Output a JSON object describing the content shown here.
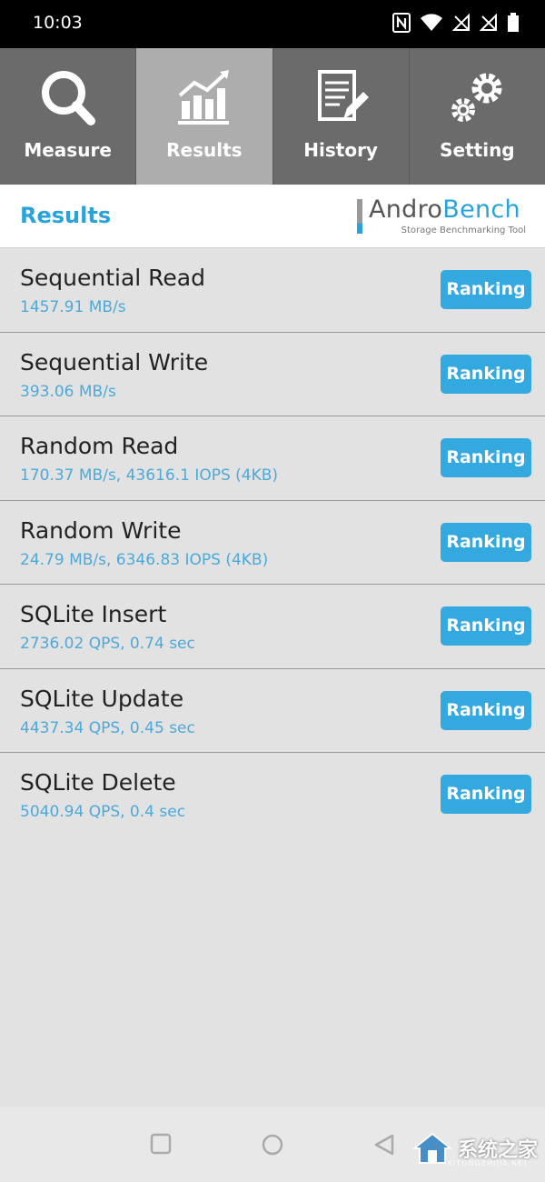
{
  "status_bar": {
    "time": "10:03",
    "icons": [
      "nfc-icon",
      "wifi-icon",
      "no-signal-icon",
      "no-signal-icon",
      "battery-icon"
    ]
  },
  "tabs": [
    {
      "label": "Measure",
      "icon": "magnifier-icon",
      "active": false
    },
    {
      "label": "Results",
      "icon": "chart-icon",
      "active": true
    },
    {
      "label": "History",
      "icon": "document-edit-icon",
      "active": false
    },
    {
      "label": "Setting",
      "icon": "gears-icon",
      "active": false
    }
  ],
  "header": {
    "title": "Results",
    "logo_andro": "Andro",
    "logo_bench": "Bench",
    "logo_sub": "Storage Benchmarking Tool"
  },
  "results": [
    {
      "title": "Sequential Read",
      "value": "1457.91 MB/s",
      "button": "Ranking"
    },
    {
      "title": "Sequential Write",
      "value": "393.06 MB/s",
      "button": "Ranking"
    },
    {
      "title": "Random Read",
      "value": "170.37 MB/s, 43616.1 IOPS (4KB)",
      "button": "Ranking"
    },
    {
      "title": "Random Write",
      "value": "24.79 MB/s, 6346.83 IOPS (4KB)",
      "button": "Ranking"
    },
    {
      "title": "SQLite Insert",
      "value": "2736.02 QPS, 0.74 sec",
      "button": "Ranking"
    },
    {
      "title": "SQLite Update",
      "value": "4437.34 QPS, 0.45 sec",
      "button": "Ranking"
    },
    {
      "title": "SQLite Delete",
      "value": "5040.94 QPS, 0.4 sec",
      "button": "Ranking"
    }
  ],
  "watermark": {
    "text": "系统之家",
    "sub": "XITONGZHIJIA.NET"
  },
  "colors": {
    "accent": "#29a3d9",
    "button": "#33a9e0",
    "tab_bg": "#6b6b6b",
    "tab_active": "#adadad"
  }
}
